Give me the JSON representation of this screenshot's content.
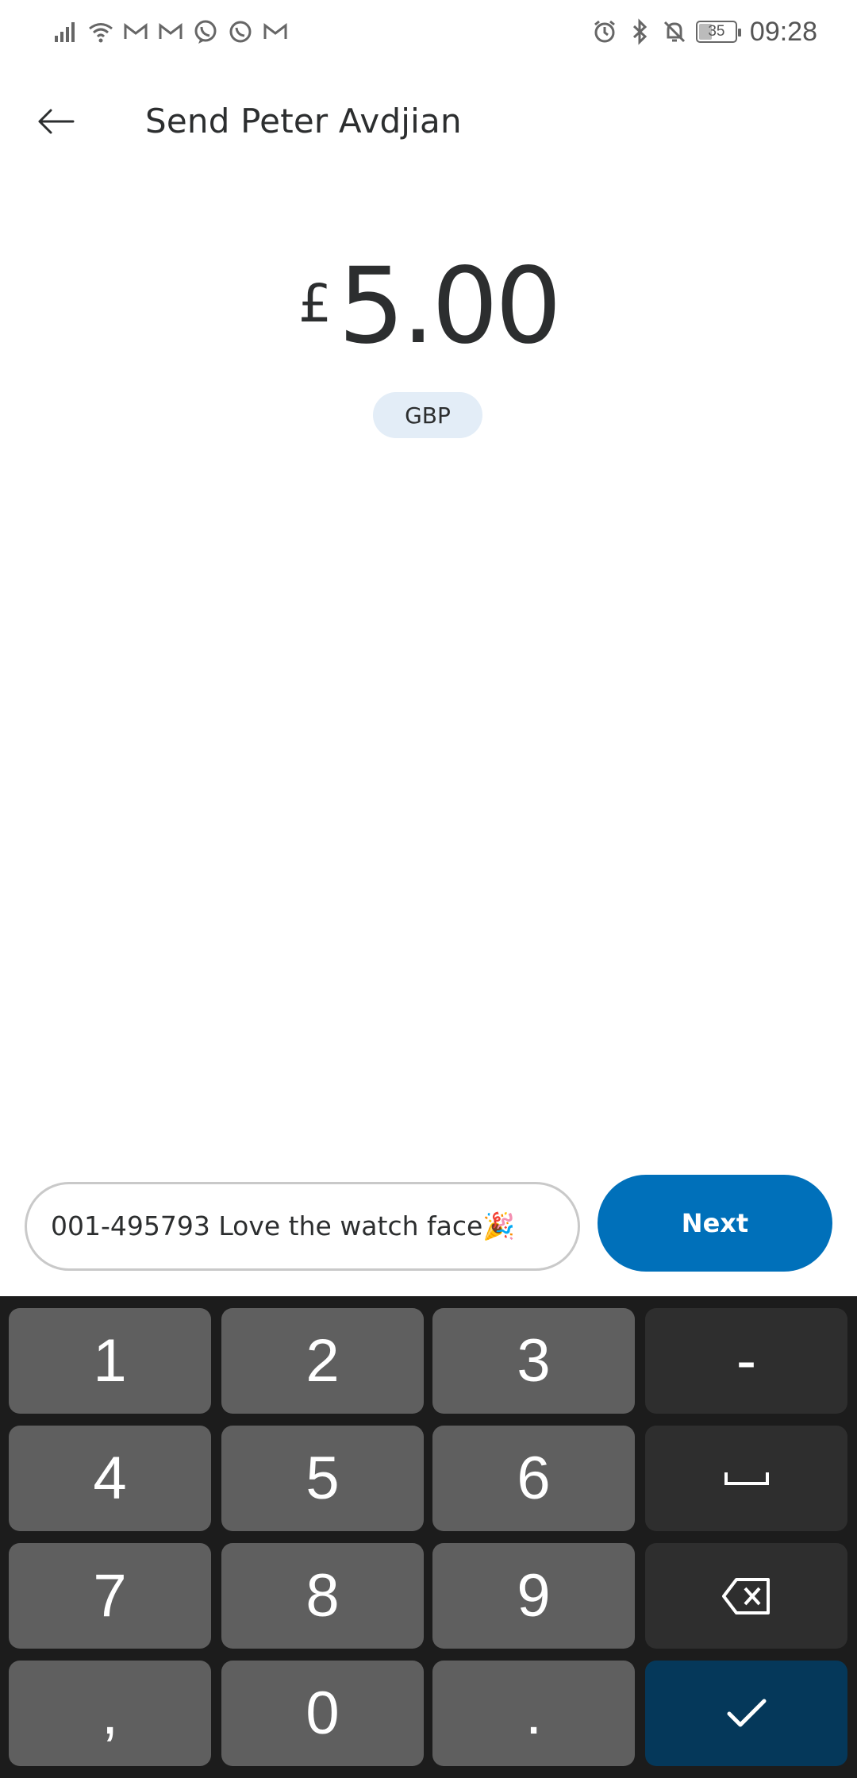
{
  "status_bar": {
    "time": "09:28",
    "battery": "35",
    "left_icons": [
      "signal-icon",
      "wifi-icon",
      "gmail-icon",
      "gmail-icon",
      "viber-icon",
      "whatsapp-icon",
      "gmail-icon"
    ],
    "right_icons": [
      "alarm-icon",
      "bluetooth-icon",
      "mute-icon",
      "battery-icon"
    ]
  },
  "header": {
    "title": "Send Peter Avdjian",
    "back_icon": "arrow-left-icon"
  },
  "amount": {
    "currency_symbol": "£",
    "value": "5.00",
    "currency_code": "GBP"
  },
  "note": {
    "value": "001-495793 Love the watch face🎉"
  },
  "actions": {
    "next_label": "Next"
  },
  "keyboard": {
    "keys": [
      "1",
      "2",
      "3",
      "-",
      "4",
      "5",
      "6",
      "space",
      "7",
      "8",
      "9",
      "backspace",
      ",",
      "0",
      ".",
      "confirm"
    ],
    "labels": {
      "k1": "1",
      "k2": "2",
      "k3": "3",
      "minus": "-",
      "k4": "4",
      "k5": "5",
      "k6": "6",
      "k7": "7",
      "k8": "8",
      "k9": "9",
      "comma": ",",
      "k0": "0",
      "dot": "."
    }
  },
  "colors": {
    "accent": "#0070ba",
    "chip_bg": "#e3edf7",
    "keyboard_bg": "#1c1c1c",
    "key_bg": "#5f5f5f",
    "key_dark_bg": "#2e2e2e",
    "confirm_bg": "#05385a"
  }
}
